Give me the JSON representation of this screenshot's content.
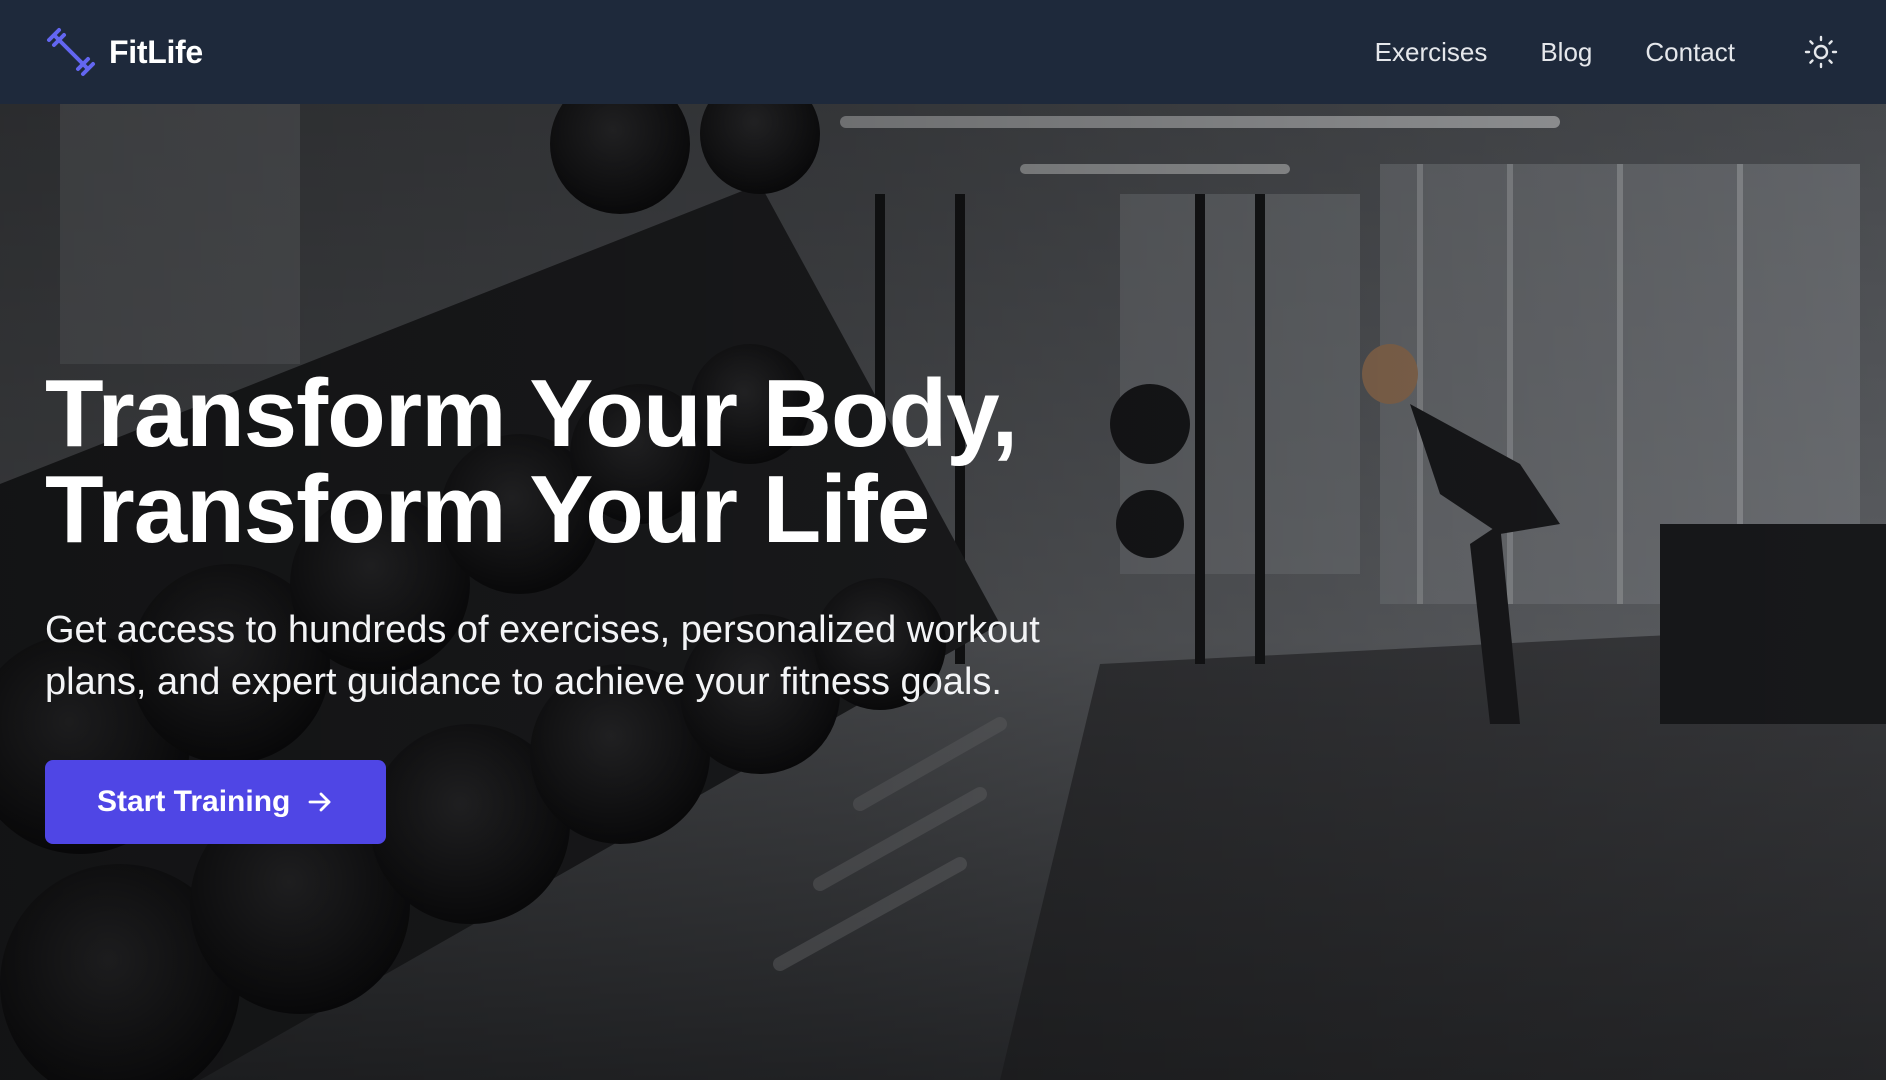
{
  "navbar": {
    "brand_name": "FitLife",
    "brand_icon": "dumbbell-icon",
    "links": [
      {
        "label": "Exercises"
      },
      {
        "label": "Blog"
      },
      {
        "label": "Contact"
      }
    ],
    "theme_icon": "sun-icon"
  },
  "hero": {
    "title_line1": "Transform Your Body,",
    "title_line2": "Transform Your Life",
    "subtitle": "Get access to hundreds of exercises, personalized workout plans, and expert guidance to achieve your fitness goals.",
    "cta_label": "Start Training",
    "cta_icon": "arrow-right-icon",
    "background": "gym-dumbbell-rack-photo"
  },
  "colors": {
    "navbar_bg": "#1e293b",
    "accent": "#4f46e5",
    "brand_icon": "#6366f1",
    "text": "#ffffff"
  }
}
